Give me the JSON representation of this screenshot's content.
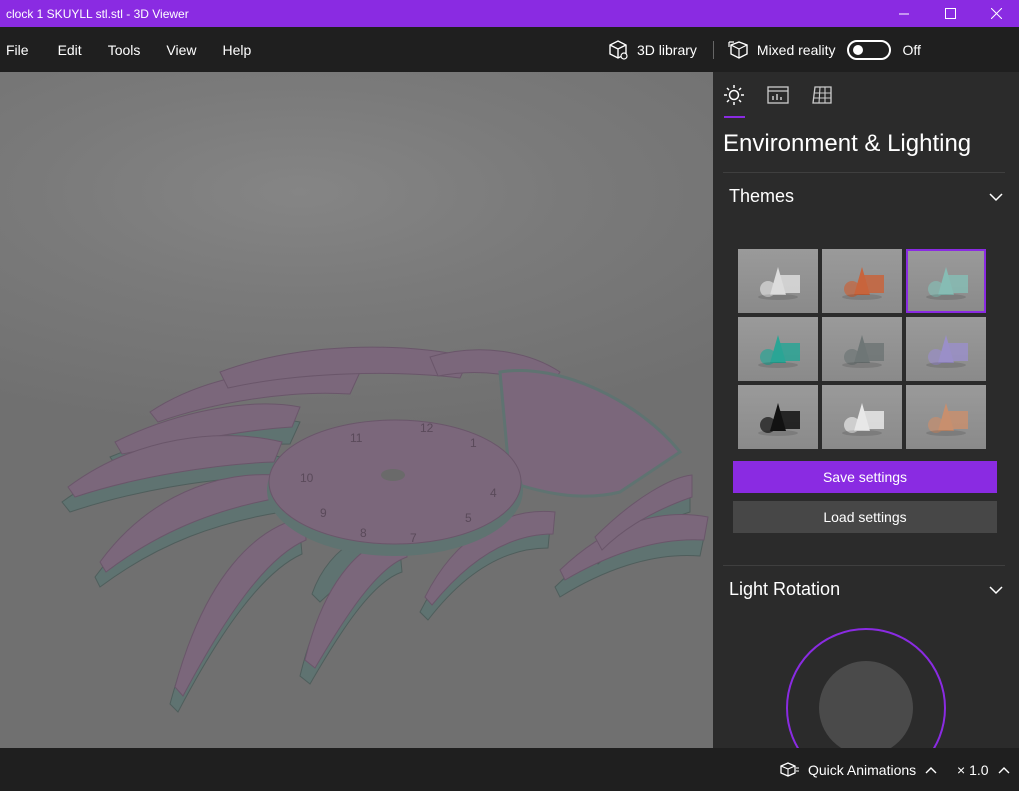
{
  "window": {
    "title": "clock 1 SKUYLL stl.stl - 3D Viewer",
    "accent": "#8a2be2"
  },
  "menu": {
    "items": [
      "File",
      "Edit",
      "Tools",
      "View",
      "Help"
    ]
  },
  "toolbar": {
    "library_label": "3D library",
    "mixed_reality_label": "Mixed reality",
    "mixed_reality_state": "Off"
  },
  "panel": {
    "heading": "Environment & Lighting",
    "tabs": [
      {
        "icon": "sun-icon",
        "selected": true
      },
      {
        "icon": "stats-icon",
        "selected": false
      },
      {
        "icon": "mesh-grid-icon",
        "selected": false
      }
    ],
    "themes": {
      "title": "Themes",
      "tiles": [
        {
          "bg": "#8a8a8a",
          "obj": "#dcdcdc",
          "selected": false
        },
        {
          "bg": "#8c8c8c",
          "obj": "#c8643c",
          "selected": false
        },
        {
          "bg": "#8a8a8a",
          "obj": "#86bcb4",
          "selected": true
        },
        {
          "bg": "#8a8a8a",
          "obj": "#2aa595",
          "selected": false
        },
        {
          "bg": "#8a8a8a",
          "obj": "#6e7676",
          "selected": false
        },
        {
          "bg": "#8a8a8a",
          "obj": "#9a8fc8",
          "selected": false
        },
        {
          "bg": "#8a8a8a",
          "obj": "#121212",
          "selected": false
        },
        {
          "bg": "#8a8a8a",
          "obj": "#e8e8e8",
          "selected": false
        },
        {
          "bg": "#8a8a8a",
          "obj": "#c88f6e",
          "selected": false
        }
      ]
    },
    "save_label": "Save settings",
    "load_label": "Load settings",
    "light_rotation_title": "Light Rotation"
  },
  "status": {
    "quick_animations_label": "Quick Animations",
    "speed": "× 1.0"
  }
}
